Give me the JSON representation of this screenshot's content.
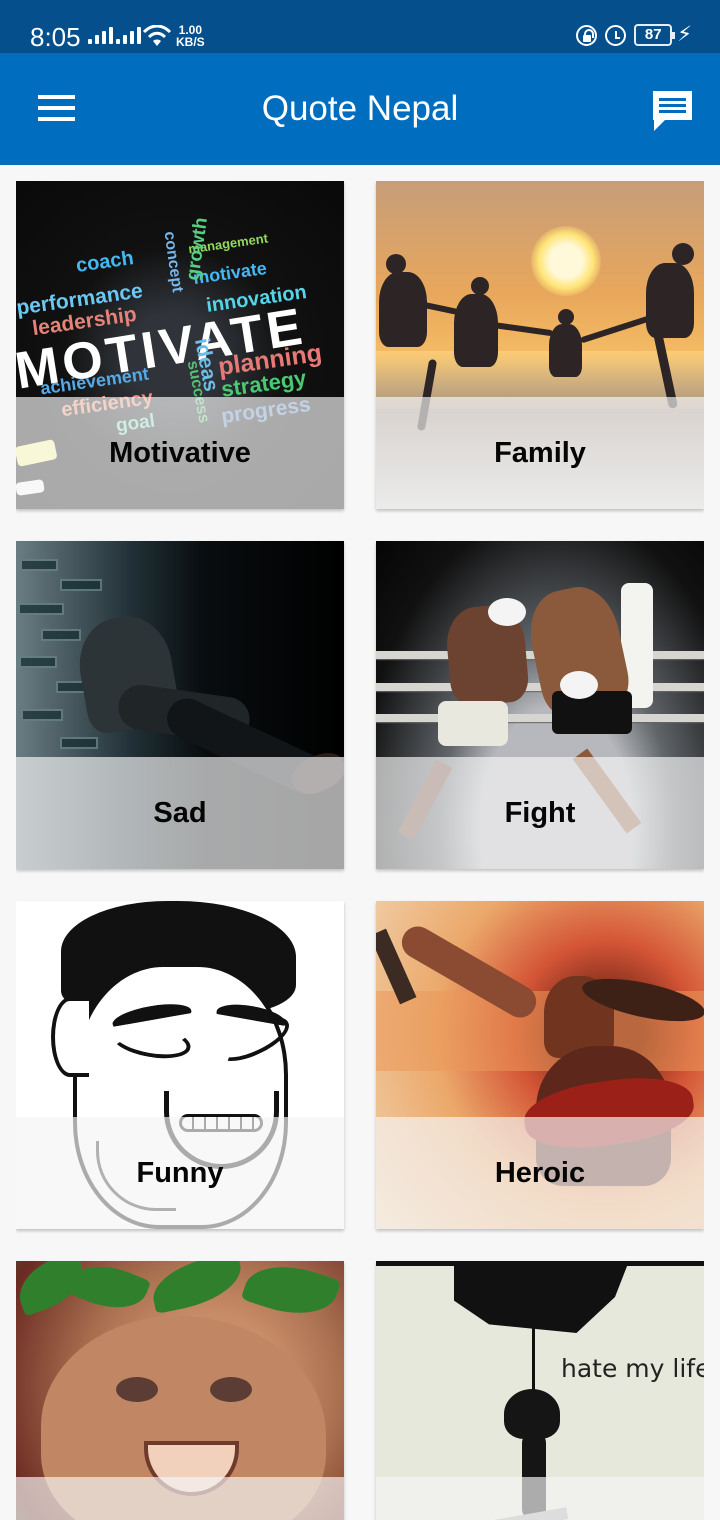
{
  "status_bar": {
    "time": "8:05",
    "network_speed_value": "1.00",
    "network_speed_unit": "KB/S",
    "battery_level": "87",
    "background_color": "#054f8c"
  },
  "app_bar": {
    "title": "Quote Nepal",
    "background_color": "#006dbf",
    "menu_icon": "menu-icon",
    "chat_icon": "message-icon"
  },
  "categories": [
    {
      "label": "Motivative"
    },
    {
      "label": "Family"
    },
    {
      "label": "Sad"
    },
    {
      "label": "Fight"
    },
    {
      "label": "Funny"
    },
    {
      "label": "Heroic"
    },
    {
      "label": ""
    },
    {
      "label": ""
    }
  ],
  "image_text": {
    "motivative_words": [
      "coach",
      "management",
      "performance",
      "motivate",
      "innovation",
      "leadership",
      "MOTIVATE",
      "planning",
      "achievement",
      "strategy",
      "efficiency",
      "goal",
      "progress",
      "concept",
      "growth",
      "ideas",
      "success"
    ],
    "hate_caption": "hate my life"
  }
}
